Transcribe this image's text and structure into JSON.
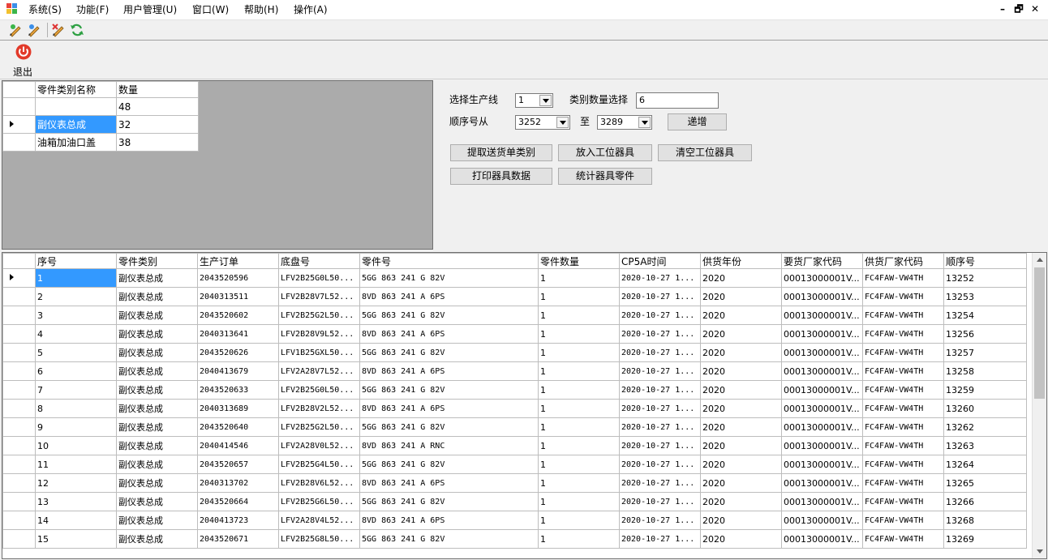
{
  "menu": {
    "items": [
      "系统(S)",
      "功能(F)",
      "用户管理(U)",
      "窗口(W)",
      "帮助(H)",
      "操作(A)"
    ],
    "window_controls": [
      "–",
      "🗗",
      "✕"
    ]
  },
  "toolbar": {
    "icons": [
      "edit-pencil-icon",
      "edit-pencil-icon",
      "pencil-cross-icon",
      "refresh-icon"
    ]
  },
  "exit": {
    "label": "退出",
    "icon": "power-icon",
    "color": "#e23a2a"
  },
  "category_grid": {
    "headers": [
      "零件类别名称",
      "数量"
    ],
    "rows": [
      {
        "name": "",
        "qty": "48"
      },
      {
        "name": "副仪表总成",
        "qty": "32"
      },
      {
        "name": "油箱加油口盖",
        "qty": "38"
      }
    ]
  },
  "controls": {
    "production_line_label": "选择生产线",
    "production_line_value": "1",
    "category_qty_label": "类别数量选择",
    "category_qty_value": "6",
    "seq_from_label": "顺序号从",
    "seq_from_value": "3252",
    "seq_to_label": "至",
    "seq_to_value": "3289",
    "increment_button": "递增",
    "buttons": [
      "提取送货单类别",
      "放入工位器具",
      "清空工位器具",
      "打印器具数据",
      "统计器具零件"
    ]
  },
  "data_grid": {
    "headers": [
      "序号",
      "零件类别",
      "生产订单",
      "底盘号",
      "零件号",
      "零件数量",
      "CP5A时间",
      "供货年份",
      "要货厂家代码",
      "供货厂家代码",
      "顺序号"
    ],
    "rows": [
      [
        "1",
        "副仪表总成",
        "2043520596",
        "LFV2B25G0L50...",
        "5GG 863 241 G  82V",
        "1",
        "2020-10-27 1...",
        "2020",
        "00013000001V...",
        "FC4FAW-VW4TH",
        "13252"
      ],
      [
        "2",
        "副仪表总成",
        "2040313511",
        "LFV2B28V7L52...",
        "8VD 863 241 A  6PS",
        "1",
        "2020-10-27 1...",
        "2020",
        "00013000001V...",
        "FC4FAW-VW4TH",
        "13253"
      ],
      [
        "3",
        "副仪表总成",
        "2043520602",
        "LFV2B25G2L50...",
        "5GG 863 241 G  82V",
        "1",
        "2020-10-27 1...",
        "2020",
        "00013000001V...",
        "FC4FAW-VW4TH",
        "13254"
      ],
      [
        "4",
        "副仪表总成",
        "2040313641",
        "LFV2B28V9L52...",
        "8VD 863 241 A  6PS",
        "1",
        "2020-10-27 1...",
        "2020",
        "00013000001V...",
        "FC4FAW-VW4TH",
        "13256"
      ],
      [
        "5",
        "副仪表总成",
        "2043520626",
        "LFV1B25GXL50...",
        "5GG 863 241 G  82V",
        "1",
        "2020-10-27 1...",
        "2020",
        "00013000001V...",
        "FC4FAW-VW4TH",
        "13257"
      ],
      [
        "6",
        "副仪表总成",
        "2040413679",
        "LFV2A28V7L52...",
        "8VD 863 241 A  6PS",
        "1",
        "2020-10-27 1...",
        "2020",
        "00013000001V...",
        "FC4FAW-VW4TH",
        "13258"
      ],
      [
        "7",
        "副仪表总成",
        "2043520633",
        "LFV2B25G0L50...",
        "5GG 863 241 G  82V",
        "1",
        "2020-10-27 1...",
        "2020",
        "00013000001V...",
        "FC4FAW-VW4TH",
        "13259"
      ],
      [
        "8",
        "副仪表总成",
        "2040313689",
        "LFV2B28V2L52...",
        "8VD 863 241 A  6PS",
        "1",
        "2020-10-27 1...",
        "2020",
        "00013000001V...",
        "FC4FAW-VW4TH",
        "13260"
      ],
      [
        "9",
        "副仪表总成",
        "2043520640",
        "LFV2B25G2L50...",
        "5GG 863 241 G  82V",
        "1",
        "2020-10-27 1...",
        "2020",
        "00013000001V...",
        "FC4FAW-VW4TH",
        "13262"
      ],
      [
        "10",
        "副仪表总成",
        "2040414546",
        "LFV2A28V0L52...",
        "8VD 863 241 A  RNC",
        "1",
        "2020-10-27 1...",
        "2020",
        "00013000001V...",
        "FC4FAW-VW4TH",
        "13263"
      ],
      [
        "11",
        "副仪表总成",
        "2043520657",
        "LFV2B25G4L50...",
        "5GG 863 241 G  82V",
        "1",
        "2020-10-27 1...",
        "2020",
        "00013000001V...",
        "FC4FAW-VW4TH",
        "13264"
      ],
      [
        "12",
        "副仪表总成",
        "2040313702",
        "LFV2B28V6L52...",
        "8VD 863 241 A  6PS",
        "1",
        "2020-10-27 1...",
        "2020",
        "00013000001V...",
        "FC4FAW-VW4TH",
        "13265"
      ],
      [
        "13",
        "副仪表总成",
        "2043520664",
        "LFV2B25G6L50...",
        "5GG 863 241 G  82V",
        "1",
        "2020-10-27 1...",
        "2020",
        "00013000001V...",
        "FC4FAW-VW4TH",
        "13266"
      ],
      [
        "14",
        "副仪表总成",
        "2040413723",
        "LFV2A28V4L52...",
        "8VD 863 241 A  6PS",
        "1",
        "2020-10-27 1...",
        "2020",
        "00013000001V...",
        "FC4FAW-VW4TH",
        "13268"
      ],
      [
        "15",
        "副仪表总成",
        "2043520671",
        "LFV2B25G8L50...",
        "5GG 863 241 G  82V",
        "1",
        "2020-10-27 1...",
        "2020",
        "00013000001V...",
        "FC4FAW-VW4TH",
        "13269"
      ]
    ]
  }
}
